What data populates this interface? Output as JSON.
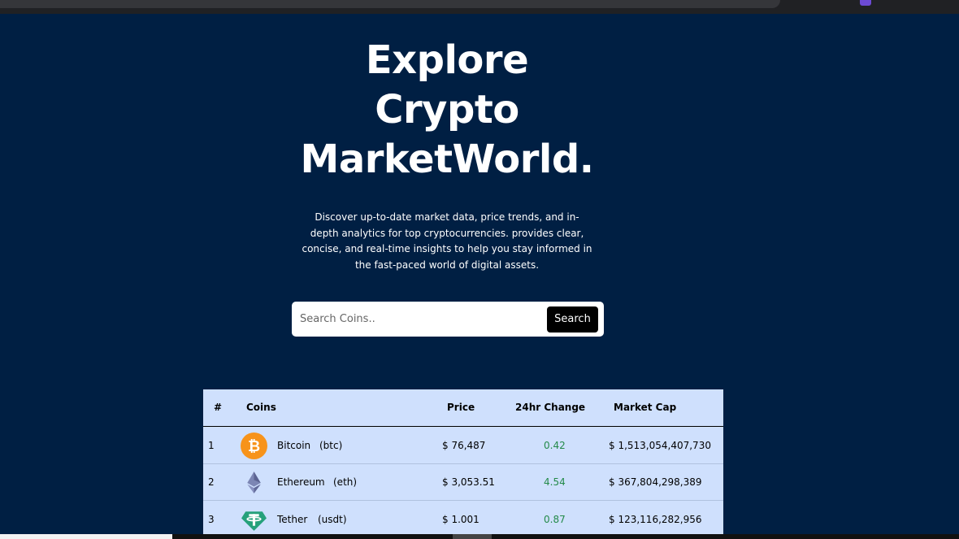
{
  "hero": {
    "title_lines": [
      "Explore",
      "Crypto",
      "MarketWorld."
    ],
    "description": "Discover up-to-date market data, price trends, and in-depth analytics for top cryptocurrencies. provides clear, concise, and real-time insights to help you stay informed in the fast-paced world of digital assets."
  },
  "search": {
    "placeholder": "Search Coins..",
    "button_label": "Search"
  },
  "table": {
    "headers": {
      "rank": "#",
      "coins": "Coins",
      "price": "Price",
      "change": "24hr Change",
      "market_cap": "Market Cap"
    },
    "rows": [
      {
        "rank": "1",
        "icon": "bitcoin-icon",
        "name": "Bitcoin",
        "symbol": "(btc)",
        "price": "$ 76,487",
        "change": "0.42",
        "market_cap": "$ 1,513,054,407,730"
      },
      {
        "rank": "2",
        "icon": "ethereum-icon",
        "name": "Ethereum",
        "symbol": "(eth)",
        "price": "$ 3,053.51",
        "change": "4.54",
        "market_cap": "$ 367,804,298,389"
      },
      {
        "rank": "3",
        "icon": "tether-icon",
        "name": "Tether",
        "symbol": "(usdt)",
        "price": "$ 1.001",
        "change": "0.87",
        "market_cap": "$ 123,116,282,956"
      }
    ]
  },
  "colors": {
    "background": "#001f43",
    "table_background": "#cfe0fd",
    "positive_change": "#248a4a",
    "bitcoin": "#f7931a",
    "tether": "#26a17b"
  }
}
